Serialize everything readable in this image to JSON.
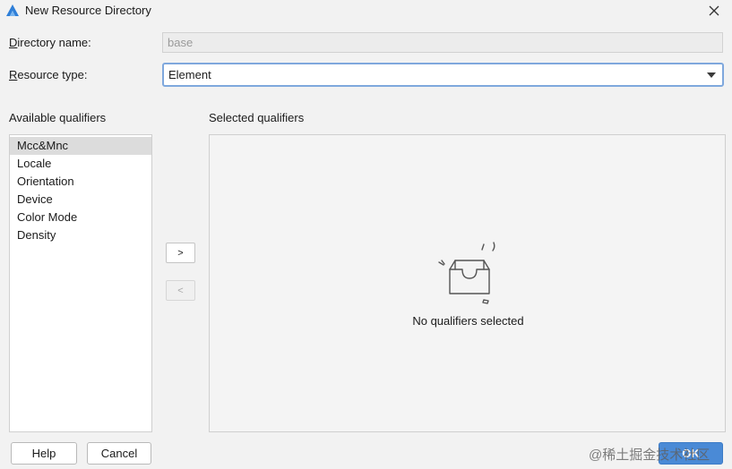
{
  "window": {
    "title": "New Resource Directory",
    "icon": "deveco-logo-icon",
    "close_icon": "close-icon"
  },
  "form": {
    "directory_name": {
      "mnemonic": "D",
      "label_rest": "irectory name:",
      "value": "base"
    },
    "resource_type": {
      "mnemonic": "R",
      "label_rest": "esource type:",
      "value": "Element"
    }
  },
  "available_qualifiers": {
    "label": "Available qualifiers",
    "items": [
      "Mcc&Mnc",
      "Locale",
      "Orientation",
      "Device",
      "Color Mode",
      "Density"
    ],
    "selected_index": 0
  },
  "selected_qualifiers": {
    "label": "Selected qualifiers",
    "empty_text": "No qualifiers selected",
    "empty_icon": "empty-box-icon"
  },
  "transfer": {
    "add_label": ">",
    "remove_label": "<"
  },
  "footer": {
    "help_label": "Help",
    "cancel_label": "Cancel",
    "ok_label": "OK"
  },
  "watermark": "@稀土掘金技术社区",
  "colors": {
    "accent": "#4a8ad6",
    "focus_border": "#7fa8dd",
    "background": "#f2f2f2"
  }
}
